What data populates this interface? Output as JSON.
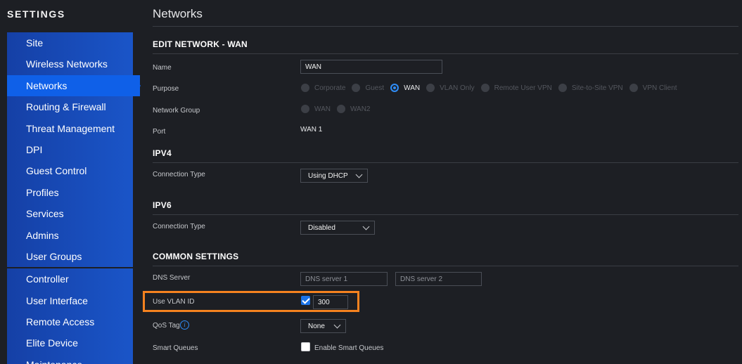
{
  "sidebar": {
    "title": "SETTINGS",
    "items": [
      {
        "label": "Site"
      },
      {
        "label": "Wireless Networks"
      },
      {
        "label": "Networks"
      },
      {
        "label": "Routing & Firewall"
      },
      {
        "label": "Threat Management"
      },
      {
        "label": "DPI"
      },
      {
        "label": "Guest Control"
      },
      {
        "label": "Profiles"
      },
      {
        "label": "Services"
      },
      {
        "label": "Admins"
      },
      {
        "label": "User Groups"
      },
      {
        "label": "Controller"
      },
      {
        "label": "User Interface"
      },
      {
        "label": "Remote Access"
      },
      {
        "label": "Elite Device"
      },
      {
        "label": "Maintenance"
      }
    ],
    "active": "Networks"
  },
  "main": {
    "title": "Networks",
    "edit_section": {
      "heading": "EDIT NETWORK - WAN",
      "name_label": "Name",
      "name_value": "WAN",
      "purpose_label": "Purpose",
      "purpose_options": [
        "Corporate",
        "Guest",
        "WAN",
        "VLAN Only",
        "Remote User VPN",
        "Site-to-Site VPN",
        "VPN Client"
      ],
      "purpose_selected": "WAN",
      "network_group_label": "Network Group",
      "network_group_options": [
        "WAN",
        "WAN2"
      ],
      "port_label": "Port",
      "port_value": "WAN 1"
    },
    "ipv4": {
      "heading": "IPV4",
      "conn_type_label": "Connection Type",
      "conn_type_value": "Using DHCP"
    },
    "ipv6": {
      "heading": "IPV6",
      "conn_type_label": "Connection Type",
      "conn_type_value": "Disabled"
    },
    "common": {
      "heading": "COMMON SETTINGS",
      "dns_label": "DNS Server",
      "dns1_placeholder": "DNS server 1",
      "dns2_placeholder": "DNS server 2",
      "vlan_label": "Use VLAN ID",
      "vlan_checked": true,
      "vlan_value": "300",
      "qos_label": "QoS Tag",
      "qos_value": "None",
      "smart_queues_label": "Smart Queues",
      "smart_queues_checkbox_label": "Enable Smart Queues",
      "smart_queues_checked": false
    }
  },
  "colors": {
    "highlight": "#f5821f",
    "accent": "#2f8cf5",
    "sidebar_active": "#0f60e8"
  }
}
